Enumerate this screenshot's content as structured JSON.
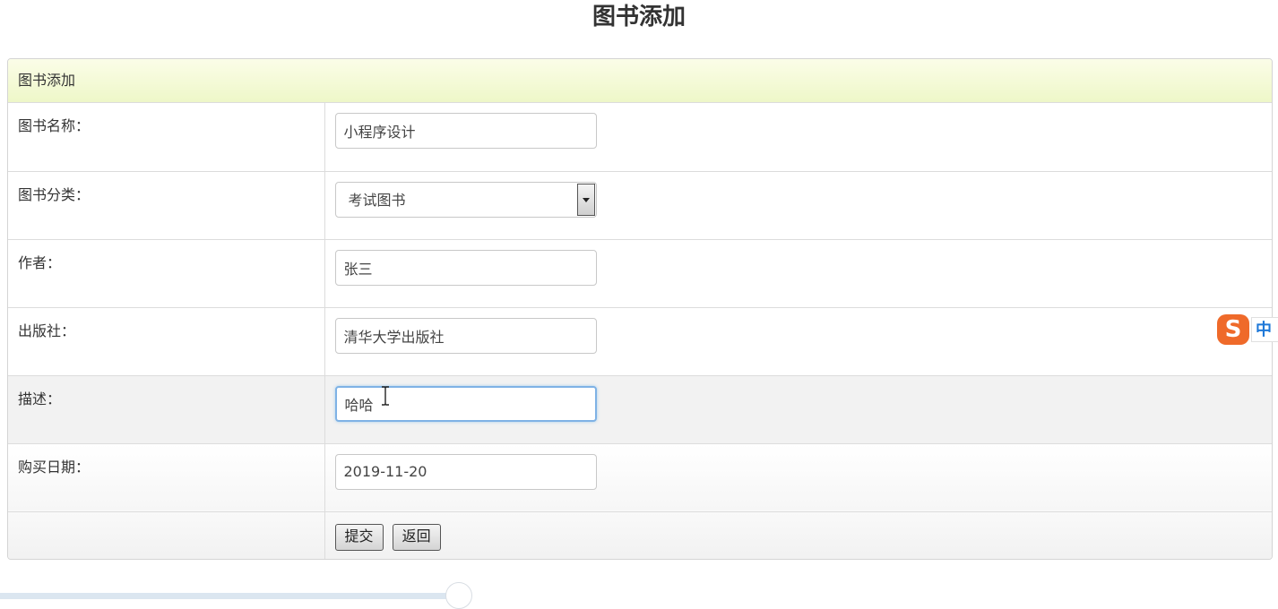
{
  "page": {
    "title": "图书添加"
  },
  "panel": {
    "header": "图书添加"
  },
  "form": {
    "name": {
      "label": "图书名称：",
      "value": "小程序设计"
    },
    "category": {
      "label": "图书分类：",
      "selected": "考试图书"
    },
    "author": {
      "label": "作者：",
      "value": "张三"
    },
    "publisher": {
      "label": "出版社：",
      "value": "清华大学出版社"
    },
    "description": {
      "label": "描述：",
      "value": "哈哈"
    },
    "purchase_date": {
      "label": "购买日期：",
      "value": "2019-11-20"
    }
  },
  "actions": {
    "submit_label": "提交",
    "back_label": "返回"
  },
  "ime": {
    "logo": "S",
    "mode": "中"
  },
  "colors": {
    "header_bg": "#eef7c8",
    "focus_border": "#7fb2e5",
    "ime_orange": "#ef6a2a",
    "ime_blue": "#1e78d8"
  }
}
